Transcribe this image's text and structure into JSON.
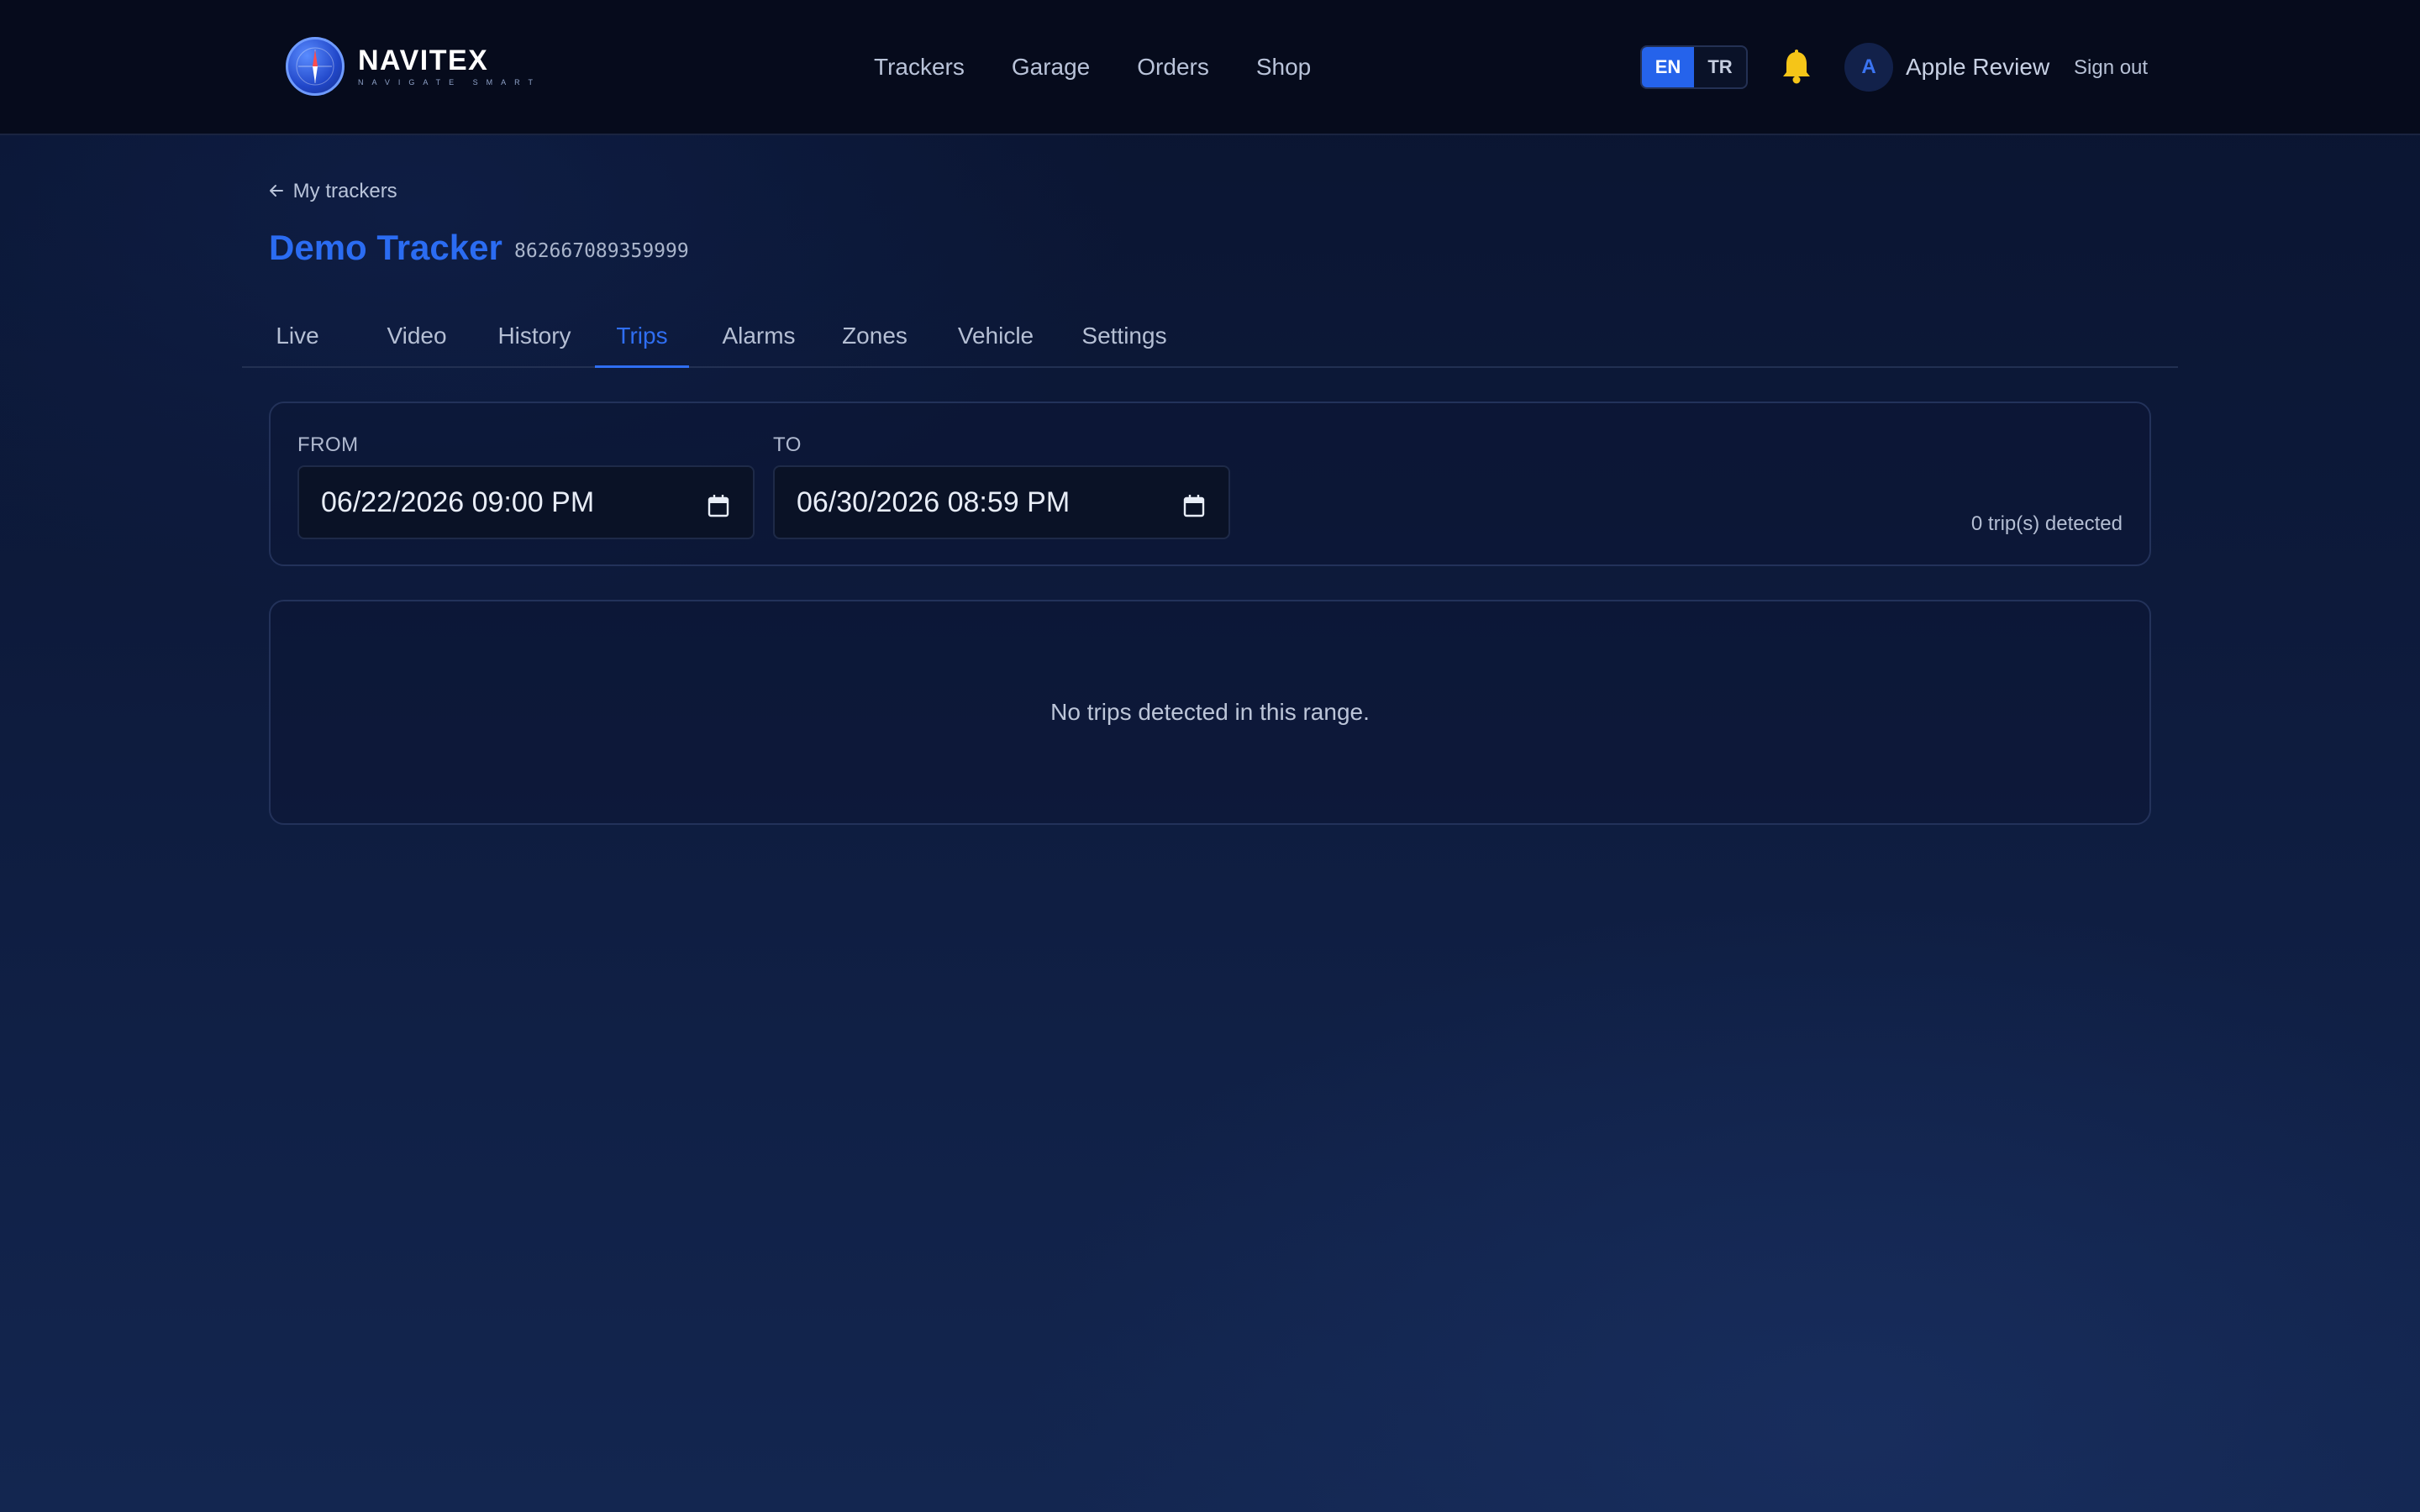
{
  "brand": {
    "name": "NAVITEX",
    "tagline": "NAVIGATE SMART"
  },
  "nav": {
    "trackers": "Trackers",
    "garage": "Garage",
    "orders": "Orders",
    "shop": "Shop"
  },
  "lang": {
    "en": "EN",
    "tr": "TR",
    "selected": "EN"
  },
  "user": {
    "initial": "A",
    "name": "Apple Review",
    "signout": "Sign out"
  },
  "icons": {
    "bell": "bell-icon",
    "calendar": "calendar-icon",
    "back": "arrow-left-icon",
    "logo": "compass-icon"
  },
  "colors": {
    "accent": "#2563eb",
    "bell": "#f5c518",
    "background": "#0d1a3b"
  },
  "page": {
    "back_label": "My trackers",
    "title": "Demo Tracker",
    "imei": "862667089359999"
  },
  "tabs": [
    {
      "label": "Live"
    },
    {
      "label": "Video"
    },
    {
      "label": "History"
    },
    {
      "label": "Trips",
      "active": true
    },
    {
      "label": "Alarms"
    },
    {
      "label": "Zones"
    },
    {
      "label": "Vehicle"
    },
    {
      "label": "Settings"
    }
  ],
  "filter": {
    "from_label": "FROM",
    "from_value": "06/22/2026 09:00 PM",
    "to_label": "TO",
    "to_value": "06/30/2026 08:59 PM",
    "count_text": "0 trip(s) detected"
  },
  "results": {
    "empty_text": "No trips detected in this range."
  }
}
